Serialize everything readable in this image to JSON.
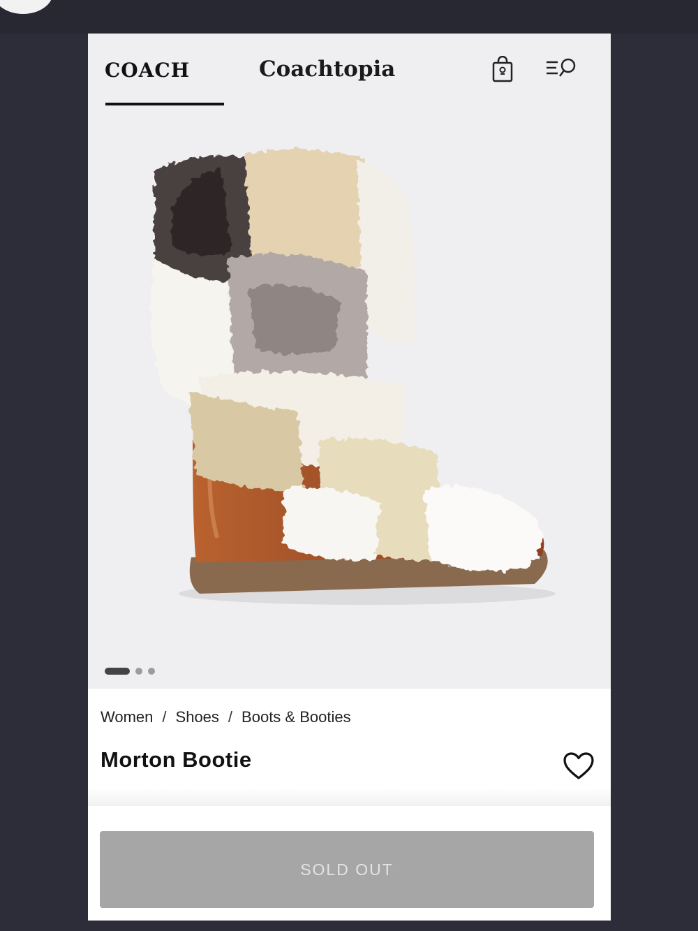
{
  "header": {
    "logo": "COACH",
    "brand_tab": "Coachtopia",
    "bag_icon": "shopping-bag-icon",
    "menu_search_icon": "menu-search-icon"
  },
  "gallery": {
    "current_slide": 1,
    "total_slides": 3
  },
  "product": {
    "breadcrumb": [
      "Women",
      "Shoes",
      "Boots & Booties"
    ],
    "breadcrumb_separator": "/",
    "name": "Morton Bootie",
    "wishlist_icon": "heart-icon",
    "cta_label": "SOLD OUT"
  },
  "colors": {
    "header_bg": "#efeef0",
    "cta_bg": "#a6a6a6",
    "cta_text": "#e4e4e4",
    "page_bg": "#2c2d38"
  }
}
